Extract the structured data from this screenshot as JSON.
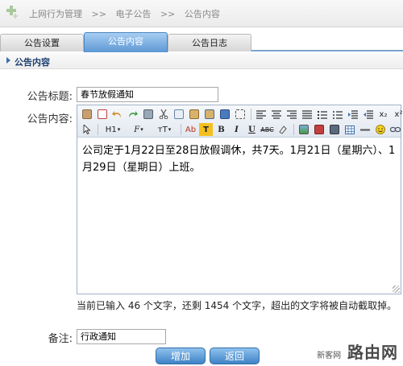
{
  "breadcrumb": [
    "上网行为管理",
    "电子公告",
    "公告内容"
  ],
  "breadcrumb_separator": ">>",
  "tabs": [
    {
      "label": "公告设置",
      "active": false
    },
    {
      "label": "公告内容",
      "active": true
    },
    {
      "label": "公告日志",
      "active": false
    }
  ],
  "section_title": "公告内容",
  "form": {
    "title_label": "公告标题:",
    "title_value": "春节放假通知",
    "content_label": "公告内容:",
    "content_text": "公司定于1月22日至28日放假调休，共7天。1月21日（星期六）、1月29日（星期日）上班。",
    "counter_text": "当前已输入 46 个文字，还剩 1454 个文字，超出的文字将被自动截取掉。",
    "note_label": "备注:",
    "note_value": "行政通知"
  },
  "toolbar": {
    "heading_label": "H1",
    "font_label": "F",
    "size_label": "тT",
    "fontcolor_label": "Ab",
    "bgcolor_label": "T",
    "bold_label": "B",
    "italic_label": "I",
    "underline_label": "U",
    "strike_label": "ABC",
    "subscript_label": "x₂",
    "superscript_label": "x²"
  },
  "buttons": {
    "add": "增加",
    "back": "返回"
  },
  "watermark": {
    "small": "新客网",
    "big": "路由网"
  },
  "colors": {
    "active_tab": "#5d98d4",
    "button": "#3f82c6",
    "section_title": "#1c3f6e"
  }
}
